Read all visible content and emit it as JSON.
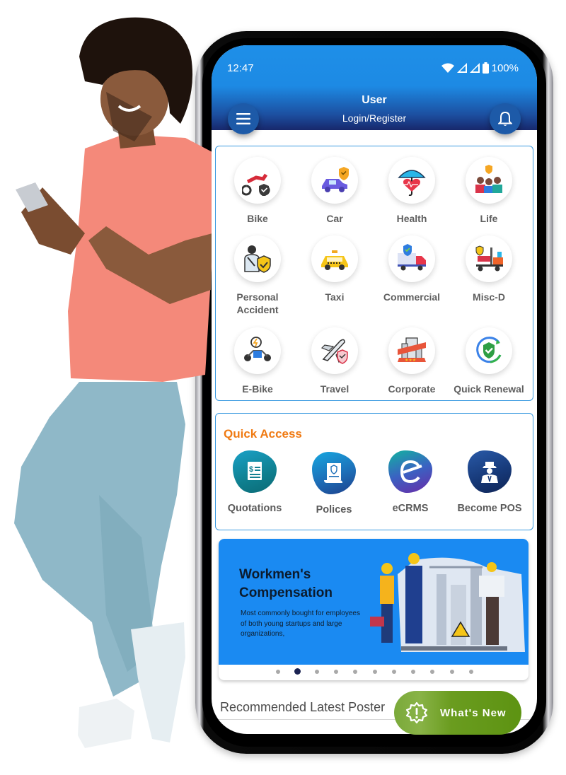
{
  "status_bar": {
    "time": "12:47",
    "battery": "100%",
    "icons": [
      "wifi-icon",
      "signal-icon",
      "signal-icon",
      "battery-icon"
    ]
  },
  "header": {
    "title": "User",
    "subtitle": "Login/Register",
    "menu_icon": "hamburger-menu-icon",
    "notification_icon": "bell-icon"
  },
  "categories": [
    {
      "label": "Bike",
      "icon": "bike-shield-icon"
    },
    {
      "label": "Car",
      "icon": "car-shield-icon"
    },
    {
      "label": "Health",
      "icon": "umbrella-heart-icon"
    },
    {
      "label": "Life",
      "icon": "family-shield-icon"
    },
    {
      "label": "Personal\nAccident",
      "icon": "injured-person-shield-icon"
    },
    {
      "label": "Taxi",
      "icon": "taxi-icon"
    },
    {
      "label": "Commercial",
      "icon": "truck-shield-icon"
    },
    {
      "label": "Misc-D",
      "icon": "forklift-icon"
    },
    {
      "label": "E-Bike",
      "icon": "electric-bike-icon"
    },
    {
      "label": "Travel",
      "icon": "airplane-shield-icon"
    },
    {
      "label": "Corporate",
      "icon": "building-ribbon-icon"
    },
    {
      "label": "Quick Renewal",
      "icon": "renewal-shield-icon"
    }
  ],
  "quick_access": {
    "title": "Quick Access",
    "items": [
      {
        "label": "Quotations",
        "icon": "quotation-document-icon"
      },
      {
        "label": "Polices",
        "icon": "policy-scroll-icon"
      },
      {
        "label": "eCRMS",
        "icon": "ecrms-logo-icon"
      },
      {
        "label": "Become POS",
        "icon": "agent-icon"
      }
    ]
  },
  "banner": {
    "title_line1": "Workmen's",
    "title_line2": "Compensation",
    "description": "Most commonly bought for employees of both young startups and large organizations,",
    "slide_count": 11,
    "active_slide": 2
  },
  "recommended": {
    "title": "Recommended Latest Poster"
  },
  "whats_new": {
    "label": "What's New",
    "icon": "alert-badge-icon"
  },
  "colors": {
    "header_blue": "#1e8fe8",
    "header_dark": "#17276b",
    "panel_border": "#3a9ae0",
    "quick_access_title": "#f07a12",
    "banner_blue": "#1a8af2",
    "whats_new_green": "#6a9c1f",
    "active_dot": "#1b2352"
  }
}
